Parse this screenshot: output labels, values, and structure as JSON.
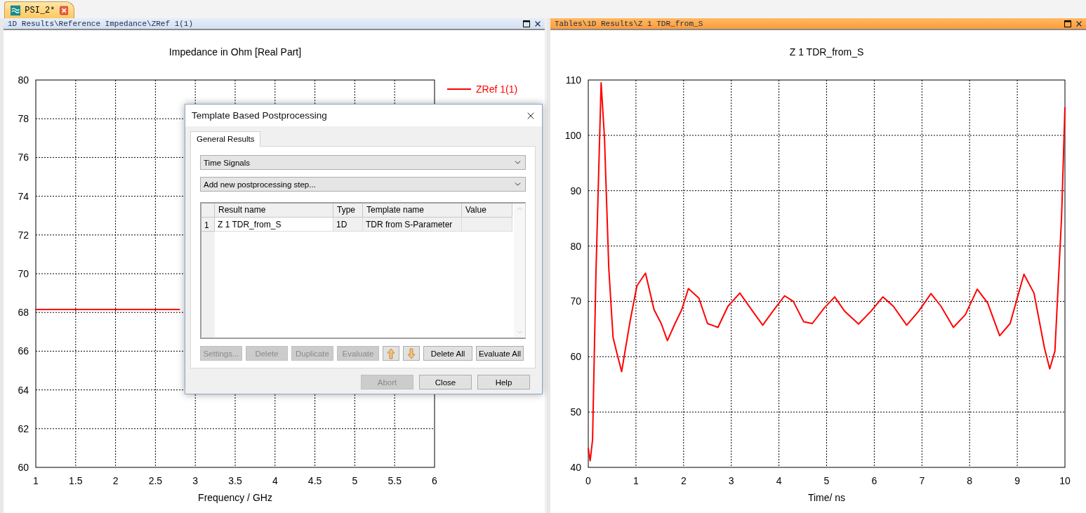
{
  "document_tabs": [
    {
      "label": "PSI_2*",
      "selected": true
    }
  ],
  "panels": [
    {
      "path": "1D Results\\Reference Impedance\\ZRef 1(1)",
      "active": false,
      "chart_data": {
        "type": "line",
        "title": "Impedance in Ohm [Real Part]",
        "xlabel": "Frequency / GHz",
        "grid": true,
        "x": [
          1,
          2.8
        ],
        "xlim": [
          1,
          6
        ],
        "ylim": [
          60,
          80
        ],
        "xticks": [
          1,
          1.5,
          2,
          2.5,
          3,
          3.5,
          4,
          4.5,
          5,
          5.5,
          6
        ],
        "yticks": [
          60,
          62,
          64,
          66,
          68,
          70,
          72,
          74,
          76,
          78,
          80
        ],
        "series": [
          {
            "name": "ZRef 1(1)",
            "color": "#ff0000",
            "values": [
              68.15,
              68.15
            ]
          }
        ]
      }
    },
    {
      "path": "Tables\\1D Results\\Z 1 TDR_from_S",
      "active": true,
      "chart_data": {
        "type": "line",
        "title": "Z 1 TDR_from_S",
        "xlabel": "Time/ ns",
        "grid": true,
        "x": [
          0,
          0.04,
          0.09,
          0.16,
          0.27,
          0.34,
          0.43,
          0.52,
          0.59,
          0.7,
          0.88,
          1.02,
          1.2,
          1.38,
          1.53,
          1.66,
          1.82,
          1.96,
          2.1,
          2.32,
          2.5,
          2.72,
          2.93,
          3.18,
          3.4,
          3.66,
          3.87,
          4.12,
          4.3,
          4.52,
          4.7,
          4.95,
          5.17,
          5.38,
          5.67,
          5.93,
          6.18,
          6.4,
          6.68,
          6.93,
          7.19,
          7.4,
          7.66,
          7.91,
          8.16,
          8.38,
          8.63,
          8.85,
          9.14,
          9.35,
          9.57,
          9.68,
          9.79,
          9.93,
          10
        ],
        "xlim": [
          0,
          10
        ],
        "ylim": [
          40,
          110
        ],
        "xticks": [
          0,
          1,
          2,
          3,
          4,
          5,
          6,
          7,
          8,
          9,
          10
        ],
        "yticks": [
          40,
          50,
          60,
          70,
          80,
          90,
          100,
          110
        ],
        "series": [
          {
            "color": "#ff0000",
            "values": [
              43.4,
              41.2,
              45,
              75,
              109.5,
              99.5,
              76,
              63.5,
              61,
              57.3,
              66.6,
              72.8,
              75.1,
              68.5,
              66,
              62.9,
              66,
              68.5,
              72.3,
              70.6,
              66,
              65.3,
              69.1,
              71.5,
              68.8,
              65.7,
              68.2,
              71,
              70,
              66.3,
              66,
              68.8,
              70.8,
              68.2,
              65.9,
              68.2,
              70.8,
              69.1,
              65.7,
              68.2,
              71.4,
              69.1,
              65.3,
              67.6,
              72.2,
              69.7,
              63.8,
              66,
              74.9,
              71.5,
              61.6,
              57.8,
              61,
              85.2,
              105
            ]
          }
        ]
      }
    }
  ],
  "dialog": {
    "title": "Template Based Postprocessing",
    "tabs": [
      {
        "label": "General Results",
        "selected": true
      }
    ],
    "dropdowns": [
      {
        "value": "Time Signals"
      },
      {
        "value": "Add new postprocessing step..."
      }
    ],
    "table": {
      "columns": [
        "Result name",
        "Type",
        "Template name",
        "Value"
      ],
      "rows": [
        {
          "index": "1",
          "cells": [
            "Z 1 TDR_from_S",
            "1D",
            "TDR from S-Parameter"
          ]
        }
      ]
    },
    "action_buttons": [
      {
        "kind": "text",
        "label": "Settings...",
        "disabled": true
      },
      {
        "kind": "text",
        "label": "Delete",
        "disabled": true
      },
      {
        "kind": "text",
        "label": "Duplicate",
        "disabled": true
      },
      {
        "kind": "text",
        "label": "Evaluate",
        "disabled": true
      },
      {
        "kind": "move-up",
        "disabled": false
      },
      {
        "kind": "move-down",
        "disabled": false
      },
      {
        "kind": "text",
        "label": "Delete All",
        "disabled": false
      },
      {
        "kind": "text",
        "label": "Evaluate All",
        "disabled": false
      }
    ],
    "footer_buttons": [
      {
        "label": "Abort",
        "disabled": true
      },
      {
        "label": "Close",
        "disabled": false
      },
      {
        "label": "Help",
        "disabled": false
      }
    ]
  }
}
